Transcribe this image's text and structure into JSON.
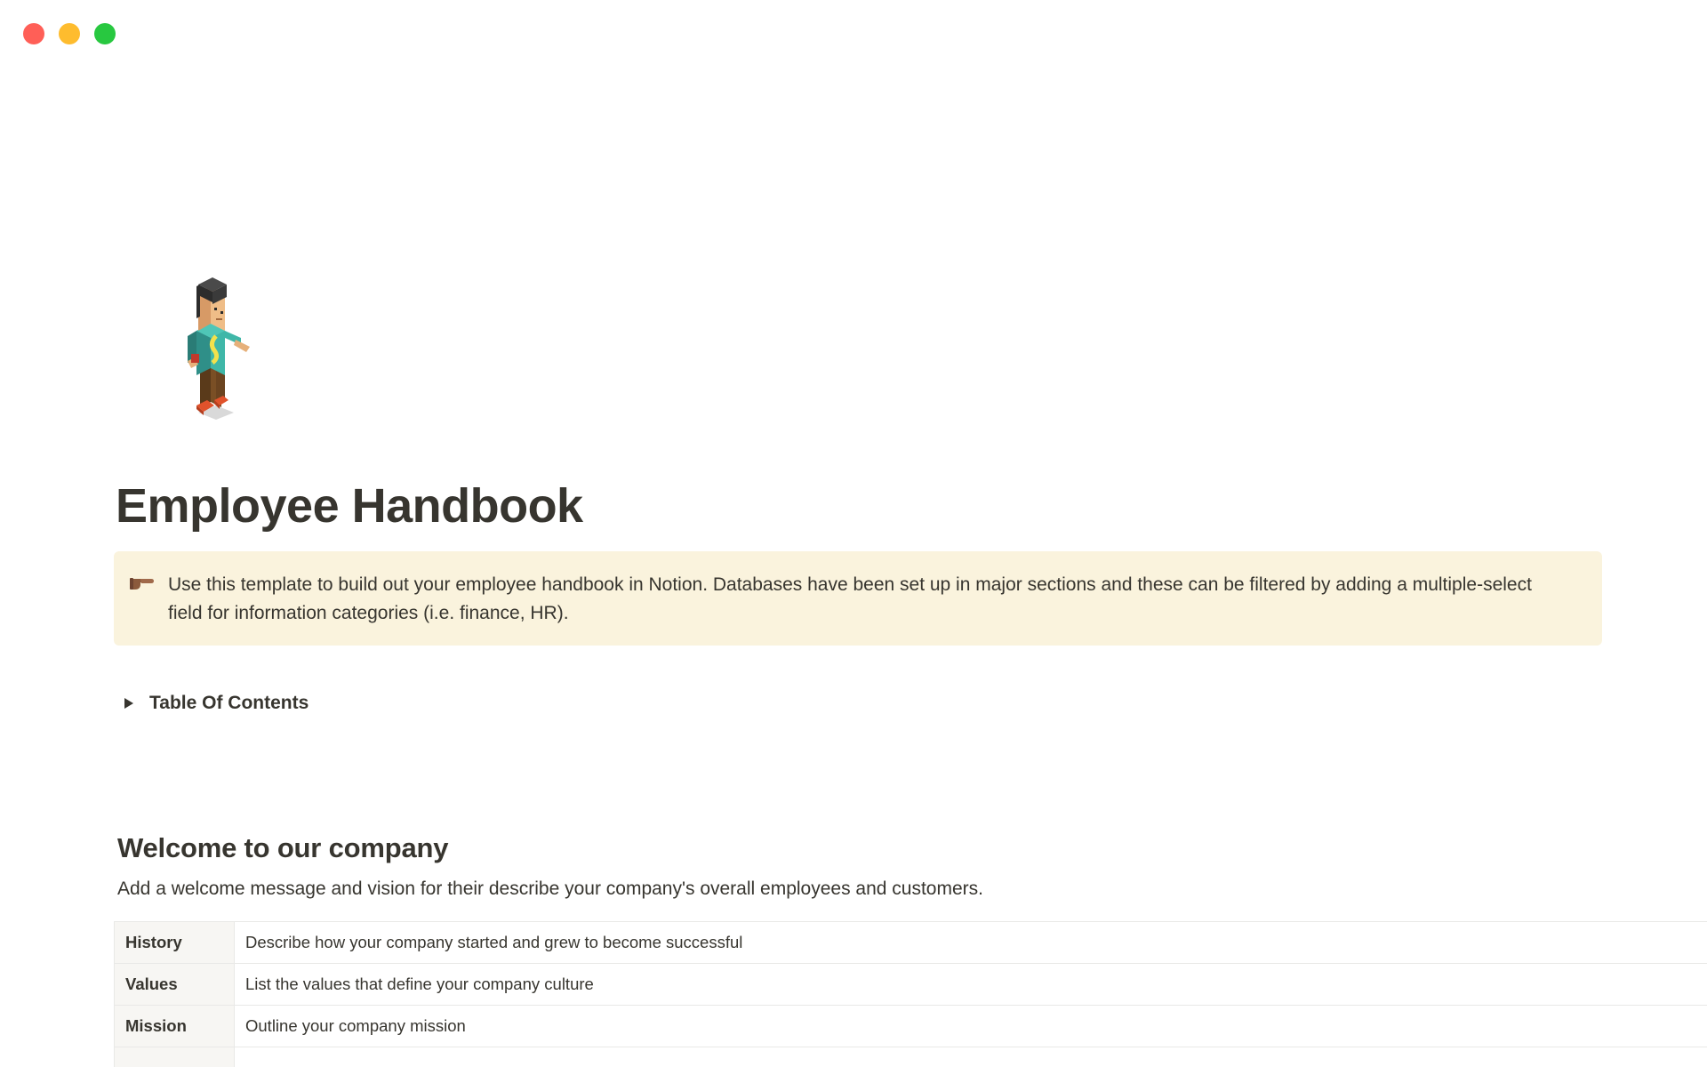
{
  "window": {
    "controls": [
      {
        "name": "close",
        "color": "#ff5f57"
      },
      {
        "name": "minimize",
        "color": "#febc2e"
      },
      {
        "name": "maximize",
        "color": "#28c840"
      }
    ]
  },
  "page": {
    "icon": "person-icon",
    "title": "Employee Handbook",
    "callout": {
      "icon": "pointing-hand-icon",
      "text": "Use this template to build out your employee handbook in Notion. Databases have been set up in major sections and these can be filtered by adding a multiple-select field for information categories (i.e. finance, HR).",
      "background": "#faf3dd"
    },
    "toggle": {
      "label": "Table Of Contents",
      "expanded": false
    },
    "welcome": {
      "heading": "Welcome to our company",
      "body": "Add a welcome message and vision for their describe your company's overall employees and customers."
    },
    "table": {
      "rows": [
        {
          "header": "History",
          "value": "Describe how your company started and grew to become successful"
        },
        {
          "header": "Values",
          "value": "List the values that define your company culture"
        },
        {
          "header": "Mission",
          "value": "Outline your company mission"
        },
        {
          "header": "",
          "value": ""
        }
      ]
    }
  }
}
